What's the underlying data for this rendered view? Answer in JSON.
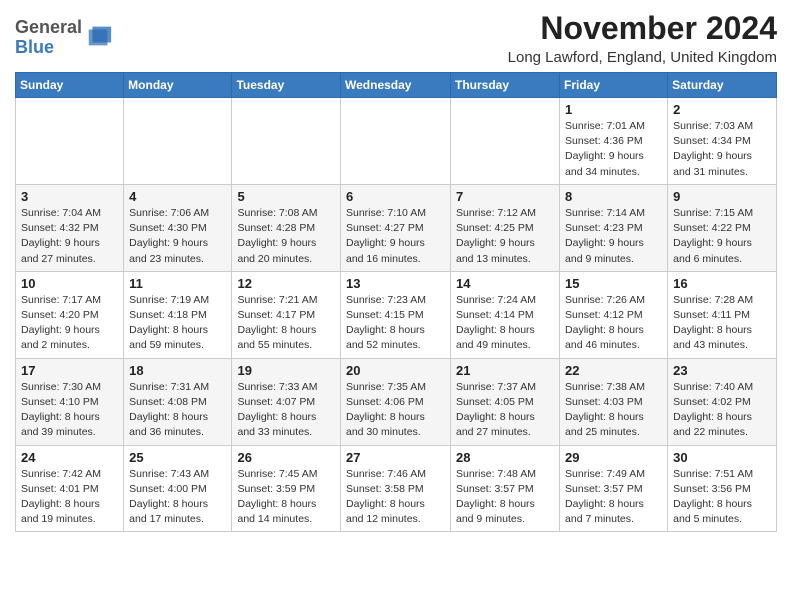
{
  "header": {
    "logo_general": "General",
    "logo_blue": "Blue",
    "month_title": "November 2024",
    "location": "Long Lawford, England, United Kingdom"
  },
  "weekdays": [
    "Sunday",
    "Monday",
    "Tuesday",
    "Wednesday",
    "Thursday",
    "Friday",
    "Saturday"
  ],
  "weeks": [
    [
      {
        "day": "",
        "info": ""
      },
      {
        "day": "",
        "info": ""
      },
      {
        "day": "",
        "info": ""
      },
      {
        "day": "",
        "info": ""
      },
      {
        "day": "",
        "info": ""
      },
      {
        "day": "1",
        "info": "Sunrise: 7:01 AM\nSunset: 4:36 PM\nDaylight: 9 hours and 34 minutes."
      },
      {
        "day": "2",
        "info": "Sunrise: 7:03 AM\nSunset: 4:34 PM\nDaylight: 9 hours and 31 minutes."
      }
    ],
    [
      {
        "day": "3",
        "info": "Sunrise: 7:04 AM\nSunset: 4:32 PM\nDaylight: 9 hours and 27 minutes."
      },
      {
        "day": "4",
        "info": "Sunrise: 7:06 AM\nSunset: 4:30 PM\nDaylight: 9 hours and 23 minutes."
      },
      {
        "day": "5",
        "info": "Sunrise: 7:08 AM\nSunset: 4:28 PM\nDaylight: 9 hours and 20 minutes."
      },
      {
        "day": "6",
        "info": "Sunrise: 7:10 AM\nSunset: 4:27 PM\nDaylight: 9 hours and 16 minutes."
      },
      {
        "day": "7",
        "info": "Sunrise: 7:12 AM\nSunset: 4:25 PM\nDaylight: 9 hours and 13 minutes."
      },
      {
        "day": "8",
        "info": "Sunrise: 7:14 AM\nSunset: 4:23 PM\nDaylight: 9 hours and 9 minutes."
      },
      {
        "day": "9",
        "info": "Sunrise: 7:15 AM\nSunset: 4:22 PM\nDaylight: 9 hours and 6 minutes."
      }
    ],
    [
      {
        "day": "10",
        "info": "Sunrise: 7:17 AM\nSunset: 4:20 PM\nDaylight: 9 hours and 2 minutes."
      },
      {
        "day": "11",
        "info": "Sunrise: 7:19 AM\nSunset: 4:18 PM\nDaylight: 8 hours and 59 minutes."
      },
      {
        "day": "12",
        "info": "Sunrise: 7:21 AM\nSunset: 4:17 PM\nDaylight: 8 hours and 55 minutes."
      },
      {
        "day": "13",
        "info": "Sunrise: 7:23 AM\nSunset: 4:15 PM\nDaylight: 8 hours and 52 minutes."
      },
      {
        "day": "14",
        "info": "Sunrise: 7:24 AM\nSunset: 4:14 PM\nDaylight: 8 hours and 49 minutes."
      },
      {
        "day": "15",
        "info": "Sunrise: 7:26 AM\nSunset: 4:12 PM\nDaylight: 8 hours and 46 minutes."
      },
      {
        "day": "16",
        "info": "Sunrise: 7:28 AM\nSunset: 4:11 PM\nDaylight: 8 hours and 43 minutes."
      }
    ],
    [
      {
        "day": "17",
        "info": "Sunrise: 7:30 AM\nSunset: 4:10 PM\nDaylight: 8 hours and 39 minutes."
      },
      {
        "day": "18",
        "info": "Sunrise: 7:31 AM\nSunset: 4:08 PM\nDaylight: 8 hours and 36 minutes."
      },
      {
        "day": "19",
        "info": "Sunrise: 7:33 AM\nSunset: 4:07 PM\nDaylight: 8 hours and 33 minutes."
      },
      {
        "day": "20",
        "info": "Sunrise: 7:35 AM\nSunset: 4:06 PM\nDaylight: 8 hours and 30 minutes."
      },
      {
        "day": "21",
        "info": "Sunrise: 7:37 AM\nSunset: 4:05 PM\nDaylight: 8 hours and 27 minutes."
      },
      {
        "day": "22",
        "info": "Sunrise: 7:38 AM\nSunset: 4:03 PM\nDaylight: 8 hours and 25 minutes."
      },
      {
        "day": "23",
        "info": "Sunrise: 7:40 AM\nSunset: 4:02 PM\nDaylight: 8 hours and 22 minutes."
      }
    ],
    [
      {
        "day": "24",
        "info": "Sunrise: 7:42 AM\nSunset: 4:01 PM\nDaylight: 8 hours and 19 minutes."
      },
      {
        "day": "25",
        "info": "Sunrise: 7:43 AM\nSunset: 4:00 PM\nDaylight: 8 hours and 17 minutes."
      },
      {
        "day": "26",
        "info": "Sunrise: 7:45 AM\nSunset: 3:59 PM\nDaylight: 8 hours and 14 minutes."
      },
      {
        "day": "27",
        "info": "Sunrise: 7:46 AM\nSunset: 3:58 PM\nDaylight: 8 hours and 12 minutes."
      },
      {
        "day": "28",
        "info": "Sunrise: 7:48 AM\nSunset: 3:57 PM\nDaylight: 8 hours and 9 minutes."
      },
      {
        "day": "29",
        "info": "Sunrise: 7:49 AM\nSunset: 3:57 PM\nDaylight: 8 hours and 7 minutes."
      },
      {
        "day": "30",
        "info": "Sunrise: 7:51 AM\nSunset: 3:56 PM\nDaylight: 8 hours and 5 minutes."
      }
    ]
  ]
}
